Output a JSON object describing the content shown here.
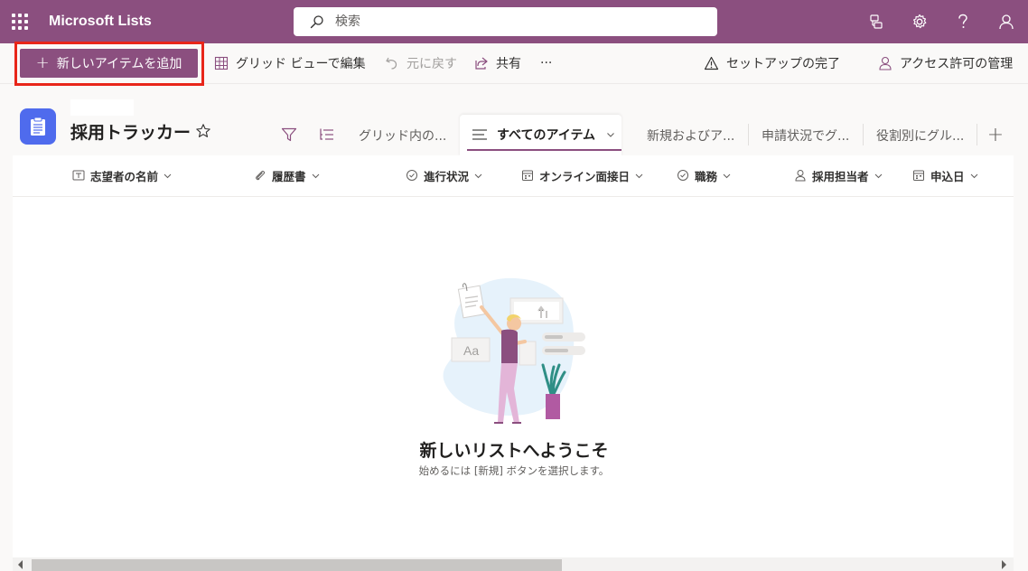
{
  "suite": {
    "app_name": "Microsoft Lists",
    "search_placeholder": "検索"
  },
  "commandbar": {
    "add_item": "新しいアイテムを追加",
    "grid_edit": "グリッド ビューで編集",
    "undo": "元に戻す",
    "share": "共有",
    "more": "···",
    "setup_complete": "セットアップの完了",
    "manage_access": "アクセス許可の管理"
  },
  "header": {
    "list_title": "採用トラッカー"
  },
  "tabs": [
    {
      "label": "グリッド内の..."
    },
    {
      "label": "すべてのアイテム"
    },
    {
      "label": "新規およびア..."
    },
    {
      "label": "申請状況でグ..."
    },
    {
      "label": "役割別にグル..."
    }
  ],
  "columns": [
    {
      "label": "志望者の名前",
      "icon": "text-icon"
    },
    {
      "label": "履歴書",
      "icon": "attachment-icon"
    },
    {
      "label": "進行状況",
      "icon": "choice-icon"
    },
    {
      "label": "オンライン面接日",
      "icon": "calendar-icon"
    },
    {
      "label": "職務",
      "icon": "choice-icon"
    },
    {
      "label": "採用担当者",
      "icon": "person-icon"
    },
    {
      "label": "申込日",
      "icon": "calendar-icon"
    }
  ],
  "empty_state": {
    "title": "新しいリストへようこそ",
    "subtitle": "始めるには [新規] ボタンを選択します。"
  },
  "colors": {
    "brand": "#8b4f7f",
    "highlight": "#e8261a",
    "list_icon": "#4f6bed"
  }
}
